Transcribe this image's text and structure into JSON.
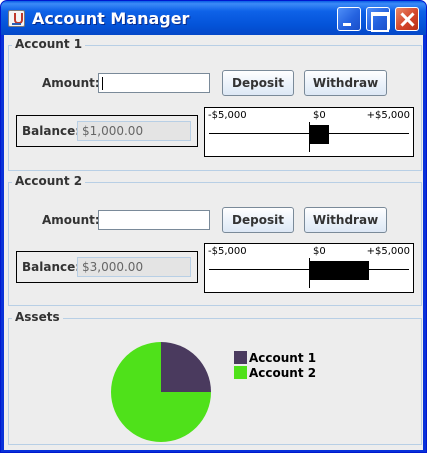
{
  "window": {
    "title": "Account Manager"
  },
  "accounts": [
    {
      "title": "Account 1",
      "amount_label": "Amount:",
      "amount_value": "",
      "deposit_label": "Deposit",
      "withdraw_label": "Withdraw",
      "balance_label": "Balance:",
      "balance_value": "$1,000.00",
      "gauge": {
        "min_label": "-$5,000",
        "zero_label": "$0",
        "max_label": "+$5,000",
        "min": -5000,
        "max": 5000,
        "value": 1000
      }
    },
    {
      "title": "Account 2",
      "amount_label": "Amount:",
      "amount_value": "",
      "deposit_label": "Deposit",
      "withdraw_label": "Withdraw",
      "balance_label": "Balance:",
      "balance_value": "$3,000.00",
      "gauge": {
        "min_label": "-$5,000",
        "zero_label": "$0",
        "max_label": "+$5,000",
        "min": -5000,
        "max": 5000,
        "value": 3000
      }
    }
  ],
  "assets": {
    "title": "Assets",
    "chart_data": {
      "type": "pie",
      "slices": [
        {
          "label": "Account 1",
          "value": 1000,
          "color": "#4a3a5e"
        },
        {
          "label": "Account 2",
          "value": 3000,
          "color": "#4fe11a"
        }
      ]
    }
  }
}
